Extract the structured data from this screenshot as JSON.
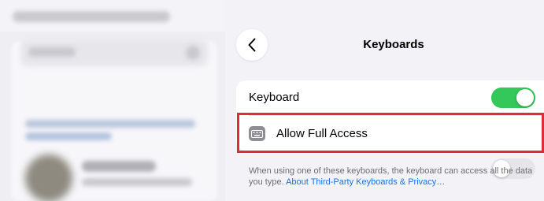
{
  "nav": {
    "title": "Keyboards",
    "back_icon": "chevron-left-icon"
  },
  "settings": {
    "keyboard_label": "Keyboard",
    "keyboard_toggle_on": true,
    "full_access_label": "Allow Full Access",
    "full_access_icon": "keyboard-icon",
    "full_access_toggle_on": false
  },
  "footer": {
    "note": "When using one of these keyboards, the keyboard can access all the data you type.",
    "link": "About Third-Party Keyboards & Privacy…"
  },
  "colors": {
    "toggle_on": "#34c759",
    "toggle_off": "#e5e5ea",
    "link": "#1a73e8",
    "highlight": "#e02b3a",
    "background": "#f2f2f7"
  }
}
